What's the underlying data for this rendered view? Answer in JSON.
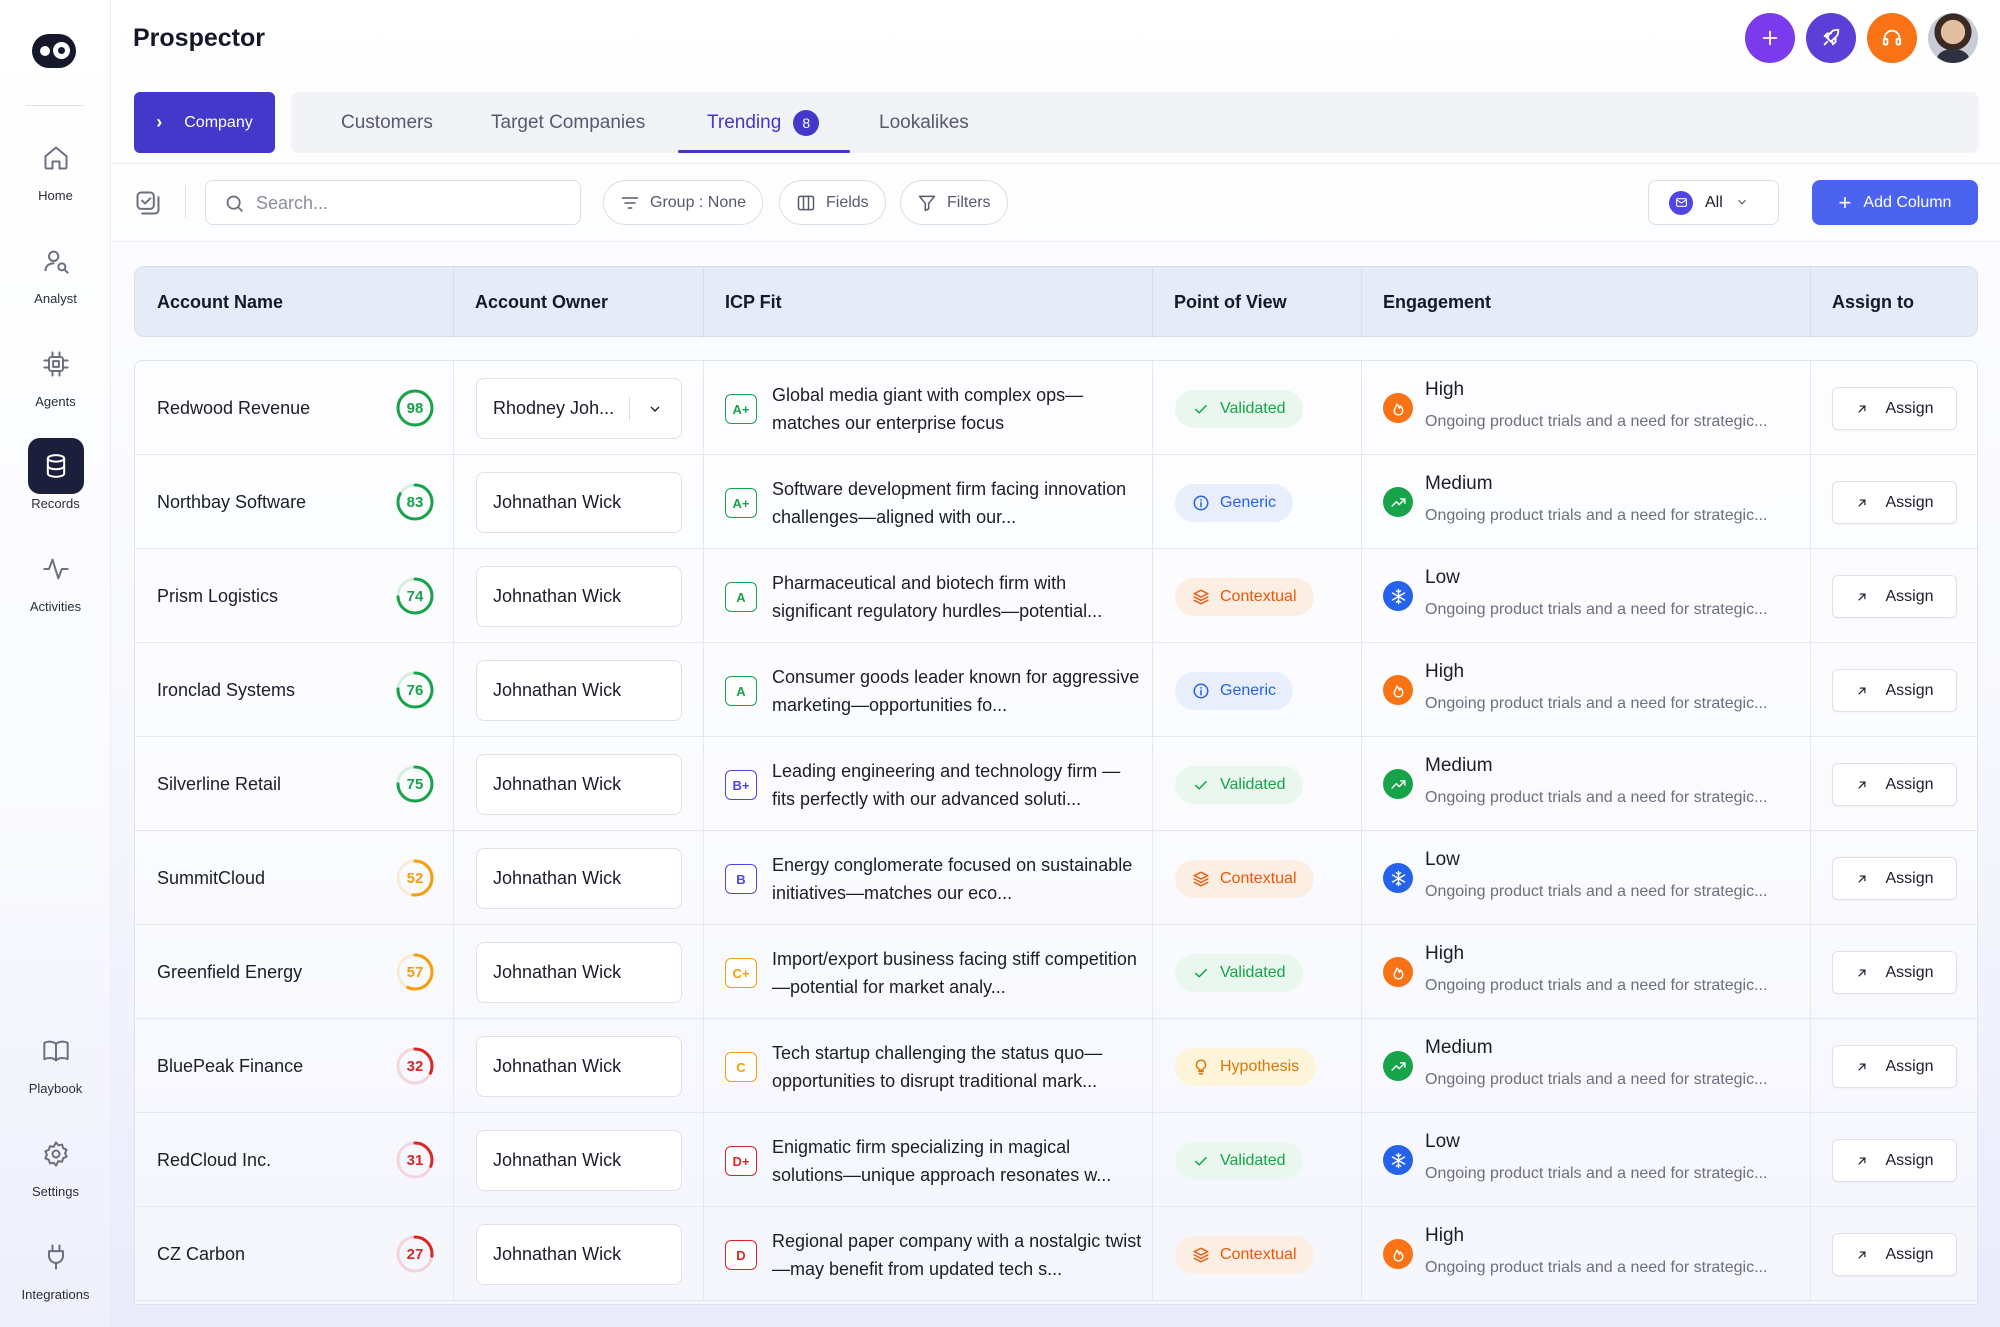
{
  "app": {
    "title": "Prospector"
  },
  "sidebar": {
    "items": [
      {
        "label": "Home",
        "icon": "home-icon"
      },
      {
        "label": "Analyst",
        "icon": "analyst-icon"
      },
      {
        "label": "Agents",
        "icon": "chip-icon"
      },
      {
        "label": "Records",
        "icon": "database-icon",
        "active": true
      },
      {
        "label": "Activities",
        "icon": "activity-icon"
      }
    ],
    "bottom_items": [
      {
        "label": "Playbook",
        "icon": "book-icon"
      },
      {
        "label": "Settings",
        "icon": "gear-icon"
      },
      {
        "label": "Integrations",
        "icon": "plug-icon"
      }
    ]
  },
  "header": {
    "buttons": [
      {
        "icon": "plus-icon",
        "color": "#7c3aed"
      },
      {
        "icon": "rocket-icon",
        "color": "#5b3fd6"
      },
      {
        "icon": "headset-icon",
        "color": "#f97316"
      }
    ]
  },
  "tabs": {
    "company_label": "Company",
    "items": [
      {
        "label": "Customers"
      },
      {
        "label": "Target Companies"
      },
      {
        "label": "Trending",
        "badge": "8",
        "active": true
      },
      {
        "label": "Lookalikes"
      }
    ]
  },
  "toolbar": {
    "search_placeholder": "Search...",
    "group_label": "Group : None",
    "fields_label": "Fields",
    "filters_label": "Filters",
    "all_label": "All",
    "add_column_label": "Add Column"
  },
  "table": {
    "columns": [
      "Account Name",
      "Account Owner",
      "ICP Fit",
      "Point of View",
      "Engagement",
      "Assign to"
    ],
    "assign_label": "Assign",
    "rows": [
      {
        "account": "Redwood Revenue",
        "score": "98",
        "score_color": "#16a34a",
        "owner": "Rhodney Joh...",
        "owner_dropdown": true,
        "grade": "A+",
        "grade_color": "#16a34a",
        "icp": "Global media giant with complex ops—matches our enterprise focus",
        "pov": "Validated",
        "engagement": "High",
        "desc": "Ongoing product trials and a need for strategic..."
      },
      {
        "account": "Northbay Software",
        "score": "83",
        "score_color": "#16a34a",
        "owner": "Johnathan Wick",
        "grade": "A+",
        "grade_color": "#16a34a",
        "icp": "Software development firm facing innovation challenges—aligned with our...",
        "pov": "Generic",
        "engagement": "Medium",
        "desc": "Ongoing product trials and a need for strategic..."
      },
      {
        "account": "Prism Logistics",
        "score": "74",
        "score_color": "#16a34a",
        "owner": "Johnathan Wick",
        "grade": "A",
        "grade_color": "#16a34a",
        "icp": "Pharmaceutical and biotech firm with significant regulatory hurdles—potential...",
        "pov": "Contextual",
        "engagement": "Low",
        "desc": "Ongoing product trials and a need for strategic..."
      },
      {
        "account": "Ironclad Systems",
        "score": "76",
        "score_color": "#16a34a",
        "owner": "Johnathan Wick",
        "grade": "A",
        "grade_color": "#16a34a",
        "icp": "Consumer goods leader known for aggressive marketing—opportunities fo...",
        "pov": "Generic",
        "engagement": "High",
        "desc": "Ongoing product trials and a need for strategic..."
      },
      {
        "account": "Silverline Retail",
        "score": "75",
        "score_color": "#16a34a",
        "owner": "Johnathan Wick",
        "grade": "B+",
        "grade_color": "#4f46e5",
        "icp": "Leading engineering and technology firm —fits perfectly with our advanced soluti...",
        "pov": "Validated",
        "engagement": "Medium",
        "desc": "Ongoing product trials and a need for strategic..."
      },
      {
        "account": "SummitCloud",
        "score": "52",
        "score_color": "#f59e0b",
        "owner": "Johnathan Wick",
        "grade": "B",
        "grade_color": "#4f46e5",
        "icp": "Energy conglomerate focused on sustainable initiatives—matches our eco...",
        "pov": "Contextual",
        "engagement": "Low",
        "desc": "Ongoing product trials and a need for strategic..."
      },
      {
        "account": "Greenfield Energy",
        "score": "57",
        "score_color": "#f59e0b",
        "owner": "Johnathan Wick",
        "grade": "C+",
        "grade_color": "#f59e0b",
        "icp": "Import/export business facing stiff competition—potential for market analy...",
        "pov": "Validated",
        "engagement": "High",
        "desc": "Ongoing product trials and a need for strategic..."
      },
      {
        "account": "BluePeak Finance",
        "score": "32",
        "score_color": "#dc2626",
        "owner": "Johnathan Wick",
        "grade": "C",
        "grade_color": "#f59e0b",
        "icp": "Tech startup challenging the status quo—opportunities to disrupt traditional mark...",
        "pov": "Hypothesis",
        "engagement": "Medium",
        "desc": "Ongoing product trials and a need for strategic..."
      },
      {
        "account": "RedCloud Inc.",
        "score": "31",
        "score_color": "#dc2626",
        "owner": "Johnathan Wick",
        "grade": "D+",
        "grade_color": "#dc2626",
        "icp": "Enigmatic firm specializing in magical solutions—unique approach resonates w...",
        "pov": "Validated",
        "engagement": "Low",
        "desc": "Ongoing product trials and a need for strategic..."
      },
      {
        "account": "CZ Carbon",
        "score": "27",
        "score_color": "#dc2626",
        "owner": "Johnathan Wick",
        "grade": "D",
        "grade_color": "#dc2626",
        "icp": "Regional paper company with a nostalgic twist—may benefit from updated tech s...",
        "pov": "Contextual",
        "engagement": "High",
        "desc": "Ongoing product trials and a need for strategic..."
      }
    ]
  },
  "pov_styles": {
    "Validated": {
      "color": "#16a34a",
      "bg": "#eaf7ee",
      "icon": "check-icon"
    },
    "Generic": {
      "color": "#2563eb",
      "bg": "#e8eefc",
      "icon": "info-icon"
    },
    "Contextual": {
      "color": "#ea580c",
      "bg": "#fdeee4",
      "icon": "layers-icon"
    },
    "Hypothesis": {
      "color": "#d97706",
      "bg": "#fdf4d9",
      "icon": "lightbulb-icon"
    }
  },
  "engagement_styles": {
    "High": {
      "color": "#f97316",
      "icon": "flame-icon"
    },
    "Medium": {
      "color": "#16a34a",
      "icon": "trend-up-icon"
    },
    "Low": {
      "color": "#2563eb",
      "icon": "snowflake-icon"
    }
  }
}
